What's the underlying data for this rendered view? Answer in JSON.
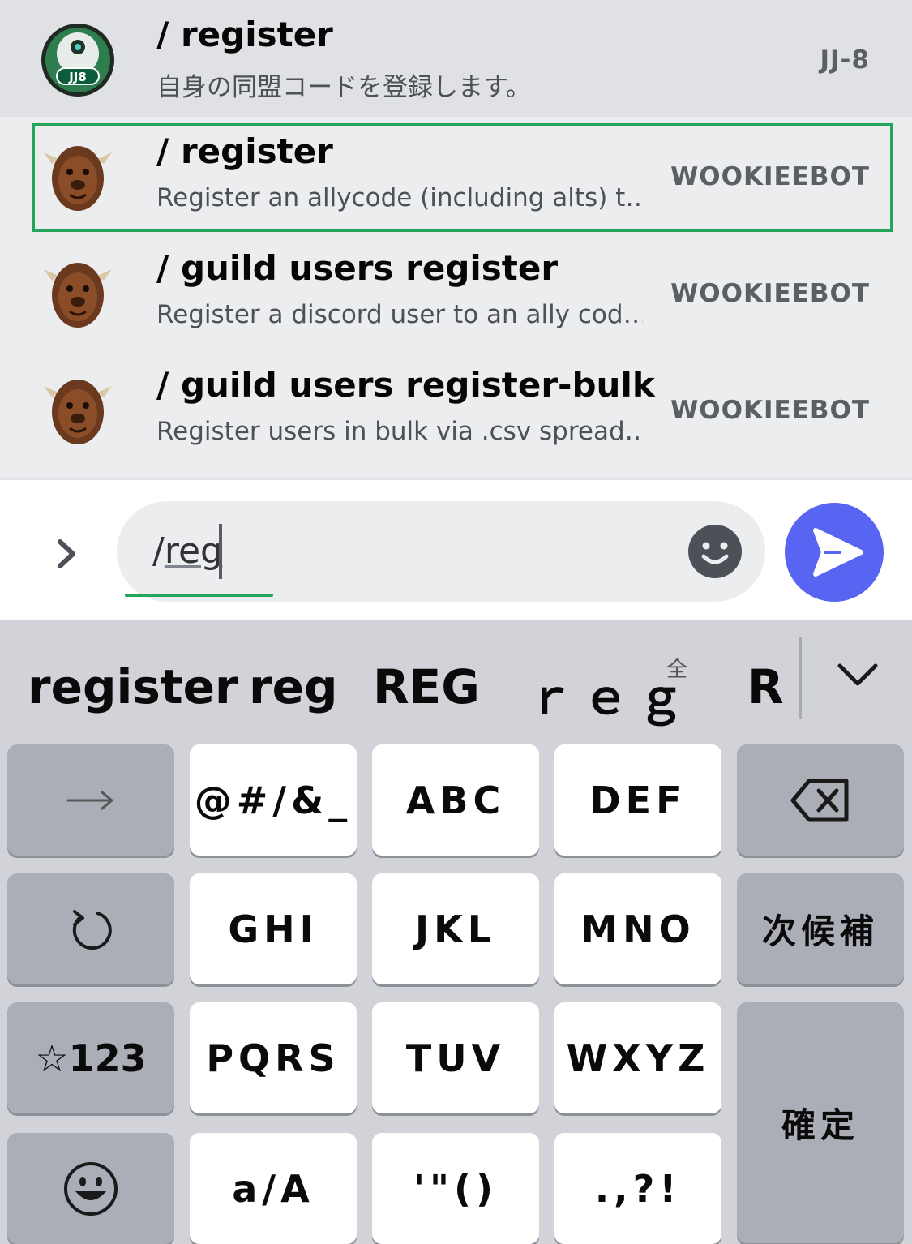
{
  "commands": [
    {
      "name": "/ register",
      "description": "自身の同盟コードを登録します。",
      "bot": "JJ-8",
      "avatar_text": "JJ8"
    },
    {
      "name": "/ register",
      "description": "Register an allycode (including alts) t…",
      "bot": "WOOKIEEBOT"
    },
    {
      "name": "/ guild users register",
      "description": "Register a discord user to an ally cod…",
      "bot": "WOOKIEEBOT"
    },
    {
      "name": "/ guild users register-bulk",
      "description": "Register users in bulk via .csv spread…",
      "bot": "WOOKIEEBOT"
    }
  ],
  "input": {
    "prefix": "/",
    "composing": "reg"
  },
  "candidates": {
    "items": [
      "register",
      "reg",
      "REG",
      "ｒｅｇ",
      "R"
    ],
    "fullwidth_mark": "全"
  },
  "keys": {
    "row1": [
      "@#/&_",
      "ABC",
      "DEF"
    ],
    "row2": [
      "GHI",
      "JKL",
      "MNO"
    ],
    "next_candidate": "次候補",
    "row3": [
      "PQRS",
      "TUV",
      "WXYZ"
    ],
    "mode": "☆123",
    "confirm": "確定",
    "row4": [
      "a/A",
      "'\"()",
      ".,?!"
    ]
  },
  "colors": {
    "accent_blue": "#5865f2",
    "selection_green": "#23a55a"
  }
}
